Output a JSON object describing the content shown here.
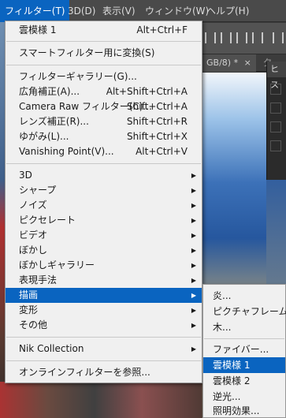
{
  "menubar": {
    "items": [
      {
        "label": "フィルター(T)"
      },
      {
        "label": "3D(D)"
      },
      {
        "label": "表示(V)"
      },
      {
        "label": "ウィンドウ(W)"
      },
      {
        "label": "ヘルプ(H)"
      }
    ]
  },
  "document": {
    "tab_label": "GB/8) *",
    "tab_close": "×",
    "tab2_label": "夕..."
  },
  "histogram_panel": {
    "title": "ヒス"
  },
  "filter_menu": {
    "items": [
      {
        "label": "雲模様 1",
        "shortcut": "Alt+Ctrl+F"
      },
      {
        "label": "スマートフィルター用に変換(S)",
        "shortcut": ""
      },
      {
        "label": "フィルターギャラリー(G)...",
        "shortcut": ""
      },
      {
        "label": "広角補正(A)...",
        "shortcut": "Alt+Shift+Ctrl+A"
      },
      {
        "label": "Camera Raw フィルター(C)...",
        "shortcut": "Shift+Ctrl+A"
      },
      {
        "label": "レンズ補正(R)...",
        "shortcut": "Shift+Ctrl+R"
      },
      {
        "label": "ゆがみ(L)...",
        "shortcut": "Shift+Ctrl+X"
      },
      {
        "label": "Vanishing Point(V)...",
        "shortcut": "Alt+Ctrl+V"
      },
      {
        "label": "3D",
        "shortcut": ""
      },
      {
        "label": "シャープ",
        "shortcut": ""
      },
      {
        "label": "ノイズ",
        "shortcut": ""
      },
      {
        "label": "ピクセレート",
        "shortcut": ""
      },
      {
        "label": "ビデオ",
        "shortcut": ""
      },
      {
        "label": "ぼかし",
        "shortcut": ""
      },
      {
        "label": "ぼかしギャラリー",
        "shortcut": ""
      },
      {
        "label": "表現手法",
        "shortcut": ""
      },
      {
        "label": "描画",
        "shortcut": ""
      },
      {
        "label": "変形",
        "shortcut": ""
      },
      {
        "label": "その他",
        "shortcut": ""
      },
      {
        "label": "Nik Collection",
        "shortcut": ""
      },
      {
        "label": "オンラインフィルターを参照...",
        "shortcut": ""
      }
    ],
    "arrow": "▶"
  },
  "render_submenu": {
    "items": [
      {
        "label": "炎..."
      },
      {
        "label": "ピクチャフレーム..."
      },
      {
        "label": "木..."
      },
      {
        "label": "ファイバー..."
      },
      {
        "label": "雲模様 1"
      },
      {
        "label": "雲模様 2"
      },
      {
        "label": "逆光..."
      },
      {
        "label": "照明効果..."
      }
    ]
  },
  "colors": {
    "highlight": "#0a64c0",
    "menu_bg": "#f0f0f0",
    "menubar_bg": "#4a4a4a"
  }
}
